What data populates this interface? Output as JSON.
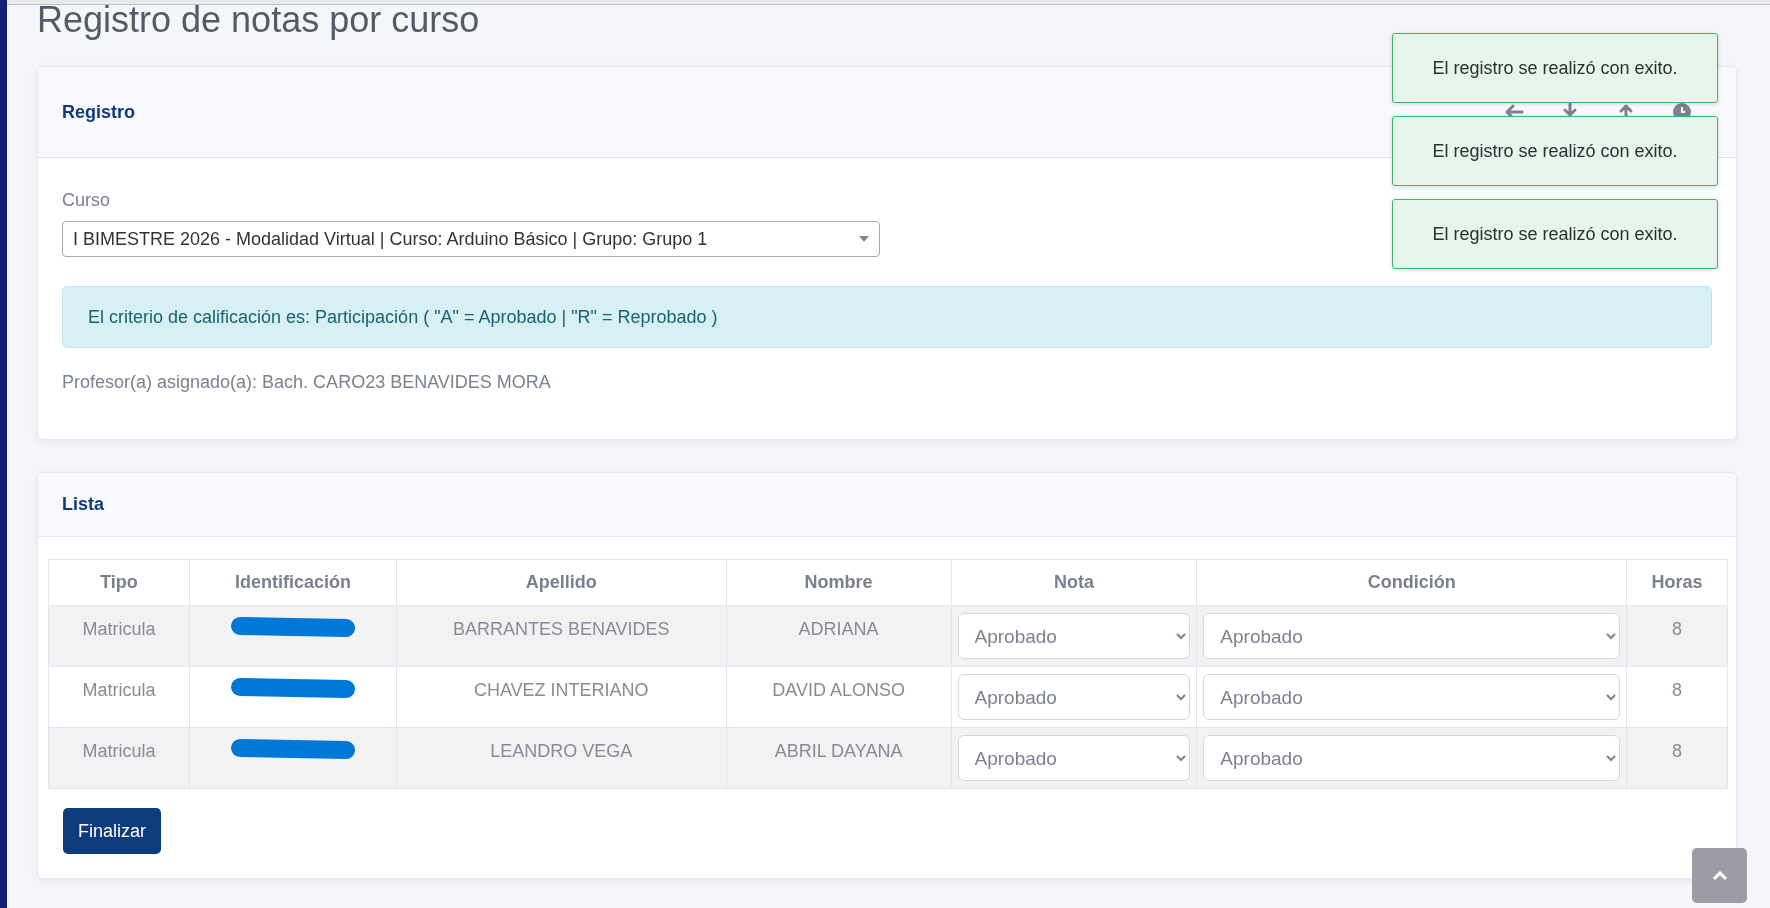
{
  "page_title": "Registro de notas por curso",
  "registro": {
    "title": "Registro",
    "course_label": "Curso",
    "course_value": "I BIMESTRE 2026 - Modalidad Virtual | Curso: Arduino Básico | Grupo: Grupo 1",
    "criterion": "El criterio de calificación es: Participación ( \"A\" = Aprobado | \"R\" = Reprobado )",
    "professor": "Profesor(a) asignado(a): Bach. CARO23 BENAVIDES MORA"
  },
  "lista": {
    "title": "Lista",
    "columns": [
      "Tipo",
      "Identificación",
      "Apellido",
      "Nombre",
      "Nota",
      "Condición",
      "Horas"
    ],
    "rows": [
      {
        "tipo": "Matricula",
        "identification_redacted": true,
        "apellido": "BARRANTES BENAVIDES",
        "nombre": "ADRIANA",
        "nota": "Aprobado",
        "condicion": "Aprobado",
        "horas": "8"
      },
      {
        "tipo": "Matricula",
        "identification_redacted": true,
        "apellido": "CHAVEZ INTERIANO",
        "nombre": "DAVID ALONSO",
        "nota": "Aprobado",
        "condicion": "Aprobado",
        "horas": "8"
      },
      {
        "tipo": "Matricula",
        "identification_redacted": true,
        "apellido": "LEANDRO VEGA",
        "nombre": "ABRIL DAYANA",
        "nota": "Aprobado",
        "condicion": "Aprobado",
        "horas": "8"
      }
    ],
    "finish_button": "Finalizar"
  },
  "toasts": [
    {
      "message": "El registro se realizó con exito."
    },
    {
      "message": "El registro se realizó con exito."
    },
    {
      "message": "El registro se realizó con exito."
    }
  ]
}
